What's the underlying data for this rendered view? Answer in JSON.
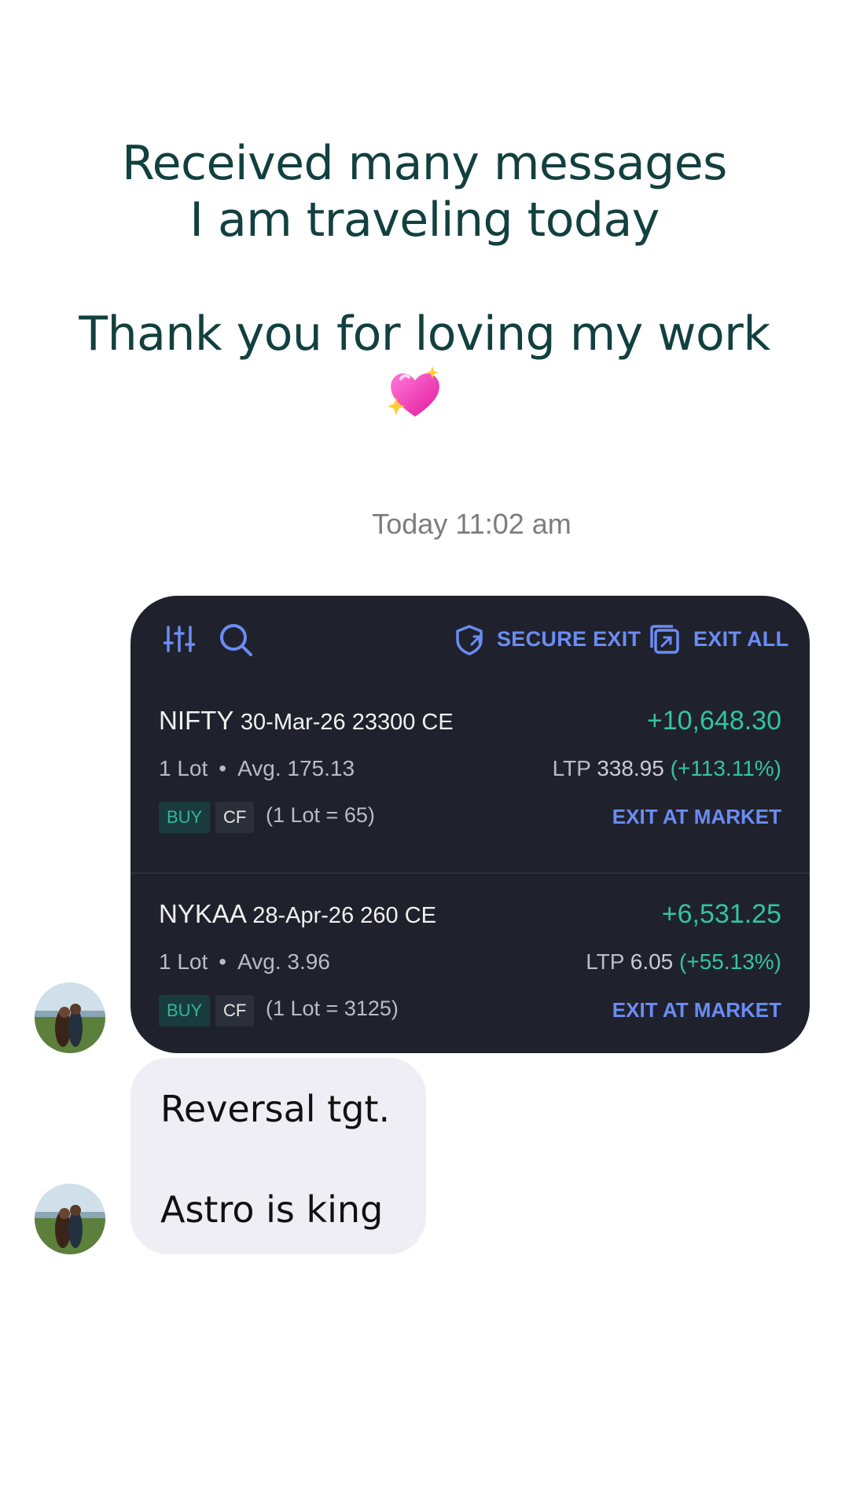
{
  "caption": {
    "line1": "Received many messages",
    "line2": "I am traveling today",
    "line3": "Thank you for loving my work",
    "emoji": "sparkling-heart"
  },
  "chat": {
    "timestamp": "Today 11:02 am",
    "message_lines": [
      "Reversal tgt.",
      "Astro is king"
    ]
  },
  "positions_card": {
    "toolbar": {
      "secure_exit_label": "SECURE EXIT",
      "exit_all_label": "EXIT ALL",
      "icons": [
        "filter-sliders-icon",
        "search-icon",
        "shield-icon",
        "exit-all-icon"
      ]
    },
    "positions": [
      {
        "symbol": "NIFTY",
        "contract": "30-Mar-26 23300 CE",
        "pnl": "+10,648.30",
        "lots": "1 Lot",
        "separator": "•",
        "avg": "Avg. 175.13",
        "ltp_label": "LTP",
        "ltp_value": "338.95",
        "ltp_change": "(+113.11%)",
        "side": "BUY",
        "product": "CF",
        "lot_size": "(1 Lot = 65)",
        "exit_label": "EXIT AT MARKET"
      },
      {
        "symbol": "NYKAA",
        "contract": "28-Apr-26 260 CE",
        "pnl": "+6,531.25",
        "lots": "1 Lot",
        "separator": "•",
        "avg": "Avg. 3.96",
        "ltp_label": "LTP",
        "ltp_value": "6.05",
        "ltp_change": "(+55.13%)",
        "side": "BUY",
        "product": "CF",
        "lot_size": "(1 Lot = 3125)",
        "exit_label": "EXIT AT MARKET"
      }
    ]
  },
  "colors": {
    "card_bg": "#1f222c",
    "accent_blue": "#6b8cf5",
    "profit_green": "#34c3a0",
    "caption_text": "#12403f",
    "bubble_bg": "#eeeef4"
  }
}
